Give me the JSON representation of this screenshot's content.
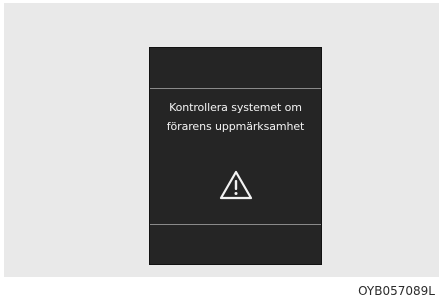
{
  "display": {
    "message_line1": "Kontrollera systemet om",
    "message_line2": "förarens uppmärksamhet",
    "icon": "warning-triangle-icon"
  },
  "figure_code": "OYB057089L",
  "colors": {
    "panel_background": "#e9e9e9",
    "display_background": "#252525",
    "text": "#f2f2f2"
  }
}
